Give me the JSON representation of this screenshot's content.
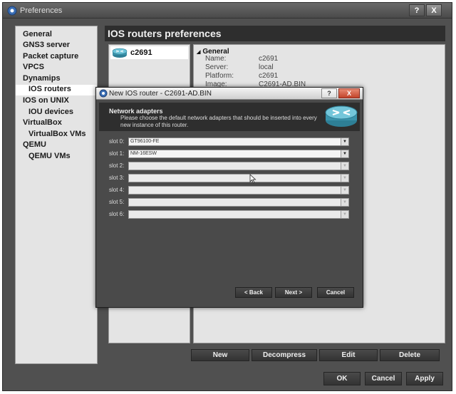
{
  "window": {
    "title": "Preferences",
    "help_label": "?",
    "close_label": "X"
  },
  "sidebar": {
    "items": [
      {
        "label": "General",
        "sub": false,
        "selected": false
      },
      {
        "label": "GNS3 server",
        "sub": false,
        "selected": false
      },
      {
        "label": "Packet capture",
        "sub": false,
        "selected": false
      },
      {
        "label": "VPCS",
        "sub": false,
        "selected": false
      },
      {
        "label": "Dynamips",
        "sub": false,
        "selected": false
      },
      {
        "label": "IOS routers",
        "sub": true,
        "selected": true
      },
      {
        "label": "IOS on UNIX",
        "sub": false,
        "selected": false
      },
      {
        "label": "IOU devices",
        "sub": true,
        "selected": false
      },
      {
        "label": "VirtualBox",
        "sub": false,
        "selected": false
      },
      {
        "label": "VirtualBox VMs",
        "sub": true,
        "selected": false
      },
      {
        "label": "QEMU",
        "sub": false,
        "selected": false
      },
      {
        "label": "QEMU VMs",
        "sub": true,
        "selected": false
      }
    ]
  },
  "panel": {
    "title": "IOS routers preferences",
    "router": {
      "label": "c2691"
    },
    "details": {
      "group": "General",
      "props": [
        {
          "key": "Name:",
          "value": "c2691"
        },
        {
          "key": "Server:",
          "value": "local"
        },
        {
          "key": "Platform:",
          "value": "c2691"
        },
        {
          "key": "Image:",
          "value": "C2691-AD.BIN"
        }
      ]
    },
    "actions": {
      "new": "New",
      "decompress": "Decompress",
      "edit": "Edit",
      "delete": "Delete"
    }
  },
  "footer": {
    "ok": "OK",
    "cancel": "Cancel",
    "apply": "Apply"
  },
  "dialog": {
    "title": "New IOS router - C2691-AD.BIN",
    "help_label": "?",
    "close_label": "X",
    "header_title": "Network adapters",
    "header_desc": "Please choose the default network adapters that should be inserted into every new instance of this router.",
    "slots": [
      {
        "label": "slot 0:",
        "value": "GT96100-FE",
        "enabled": true
      },
      {
        "label": "slot 1:",
        "value": "NM-16ESW",
        "enabled": true
      },
      {
        "label": "slot 2:",
        "value": "",
        "enabled": false
      },
      {
        "label": "slot 3:",
        "value": "",
        "enabled": false
      },
      {
        "label": "slot 4:",
        "value": "",
        "enabled": false
      },
      {
        "label": "slot 5:",
        "value": "",
        "enabled": false
      },
      {
        "label": "slot 6:",
        "value": "",
        "enabled": false
      }
    ],
    "buttons": {
      "back": "< Back",
      "next": "Next >",
      "cancel": "Cancel"
    }
  },
  "colors": {
    "window_bg": "#505050",
    "panel_header": "#2e2e2e",
    "list_bg": "#e4e4e4",
    "close_red": "#c2442a"
  }
}
